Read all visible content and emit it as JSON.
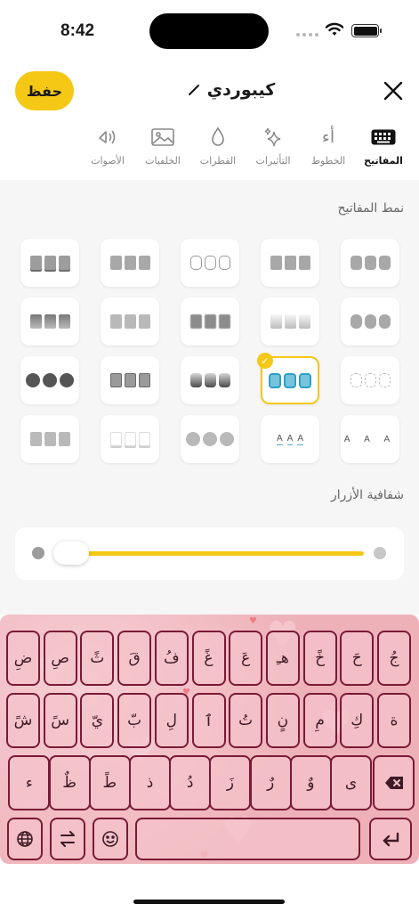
{
  "status": {
    "time": "8:42"
  },
  "header": {
    "save_label": "حفظ",
    "title": "كيبوردي"
  },
  "tabs": [
    {
      "label": "المفاتيح",
      "icon": "keyboard-icon",
      "active": true
    },
    {
      "label": "الخطوط",
      "icon": "font-alef-icon",
      "glyph": "أء",
      "active": false
    },
    {
      "label": "التأثيرات",
      "icon": "sparkles-icon",
      "active": false
    },
    {
      "label": "القطرات",
      "icon": "drop-icon",
      "active": false
    },
    {
      "label": "الخلفيات",
      "icon": "image-icon",
      "active": false
    },
    {
      "label": "الأصوات",
      "icon": "sound-icon",
      "active": false
    }
  ],
  "key_style": {
    "label": "نمط المفاتيح",
    "selected_index": 10,
    "sample_letters": [
      "A",
      "A",
      "A"
    ]
  },
  "opacity": {
    "label": "شفافية الأزرار",
    "value": 0.05
  },
  "keyboard": {
    "row1": [
      "جُ",
      "حَ",
      "خً",
      "هـِ",
      "عَ",
      "غً",
      "فُ",
      "قَ",
      "ثً",
      "صِ",
      "ضِ"
    ],
    "row2": [
      "ة",
      "كِ",
      "مِ",
      "نٍ",
      "تُ",
      "ٱ",
      "لِ",
      "بّ",
      "يّ",
      "سً",
      "شً"
    ],
    "row3": [
      "ى",
      "وٌ",
      "رٌ",
      "زَ",
      "دُ",
      "ذ",
      "طً",
      "ظٌ",
      "ء"
    ],
    "icons": [
      "globe-icon",
      "switch-icon",
      "emoji-icon",
      "return-icon",
      "backspace-icon"
    ]
  },
  "colors": {
    "accent": "#f5c816",
    "keyboard_bg": "#eeb5bb",
    "key_border": "#7a1a36",
    "selected_style": "#2ba0c7"
  }
}
